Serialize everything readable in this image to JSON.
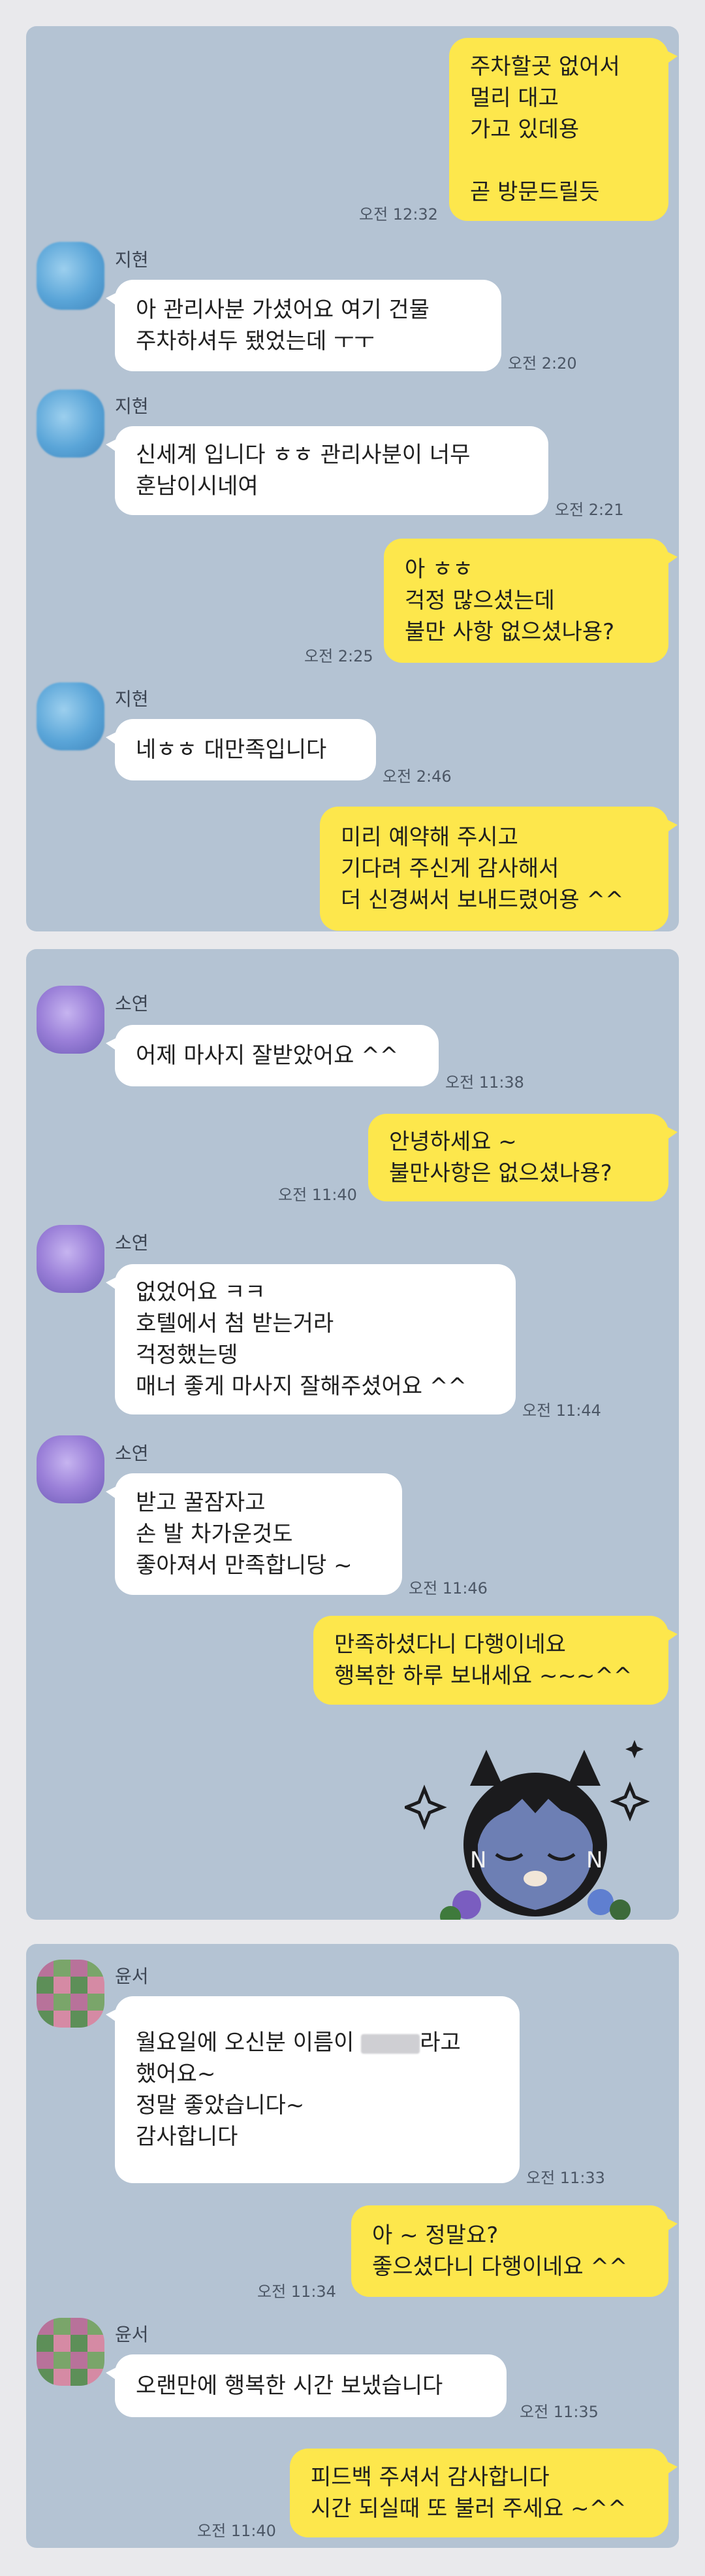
{
  "panel1": {
    "m1": {
      "lines": [
        "주차할곳 없어서",
        "멀리 대고",
        "가고 있데용",
        "",
        "곧 방문드릴듯"
      ],
      "time": "오전 12:32"
    },
    "m2": {
      "name": "지현",
      "lines": [
        "아 관리사분 가셨어요 여기 건물",
        "주차하셔두 됐었는데 ㅜㅜ"
      ],
      "time": "오전 2:20"
    },
    "m3": {
      "name": "지현",
      "lines": [
        "신세계 입니다 ㅎㅎ 관리사분이 너무",
        "훈남이시네여"
      ],
      "time": "오전 2:21"
    },
    "m4": {
      "lines": [
        "아 ㅎㅎ",
        "걱정 많으셨는데",
        "불만 사항 없으셨나용?"
      ],
      "time": "오전 2:25"
    },
    "m5": {
      "name": "지현",
      "lines": [
        "네ㅎㅎ 대만족입니다"
      ],
      "time": "오전 2:46"
    },
    "m6": {
      "lines": [
        "미리 예약해 주시고",
        "기다려 주신게 감사해서",
        "더 신경써서 보내드렸어용 ^^"
      ]
    }
  },
  "panel2": {
    "m1": {
      "name": "소연",
      "lines": [
        "어제 마사지 잘받았어요 ^^"
      ],
      "time": "오전 11:38"
    },
    "m2": {
      "lines": [
        "안녕하세요 ~",
        "불만사항은 없으셨나용?"
      ],
      "time": "오전 11:40"
    },
    "m3": {
      "name": "소연",
      "lines": [
        "없었어요 ㅋㅋ",
        "호텔에서 첨 받는거라",
        "걱정했는뎅",
        "매너 좋게 마사지 잘해주셨어요 ^^"
      ],
      "time": "오전 11:44"
    },
    "m4": {
      "name": "소연",
      "lines": [
        "받고 꿀잠자고",
        "손 발 차가운것도",
        "좋아져서 만족합니당 ~"
      ],
      "time": "오전 11:46"
    },
    "m5": {
      "lines": [
        "만족하셨다니 다행이네요",
        "행복한 하루 보내세요 ~~~^^"
      ]
    },
    "sticker": {
      "name": "kakao-sleeping-character-sticker",
      "letters": "N N"
    }
  },
  "panel3": {
    "m1": {
      "name": "윤서",
      "line1a": "월요일에 오신분 이름이 ",
      "line1b": "라고",
      "lines_rest": [
        "했어요~",
        "정말 좋았습니다~",
        "감사합니다"
      ],
      "time": "오전 11:33"
    },
    "m2": {
      "lines": [
        "아 ~ 정말요?",
        "좋으셨다니 다행이네요 ^^"
      ],
      "time": "오전 11:34"
    },
    "m3": {
      "name": "윤서",
      "lines": [
        "오랜만에 행복한 시간 보냈습니다"
      ],
      "time": "오전 11:35"
    },
    "m4": {
      "lines": [
        "피드백 주셔서 감사합니다",
        "시간 되실때 또 불러 주세요 ~^^"
      ],
      "time": "오전 11:40"
    }
  },
  "colors": {
    "panel_bg": "#b4c3d3",
    "incoming_bubble": "#ffffff",
    "outgoing_bubble": "#fde74c",
    "page_bg": "#e9e9ec"
  }
}
